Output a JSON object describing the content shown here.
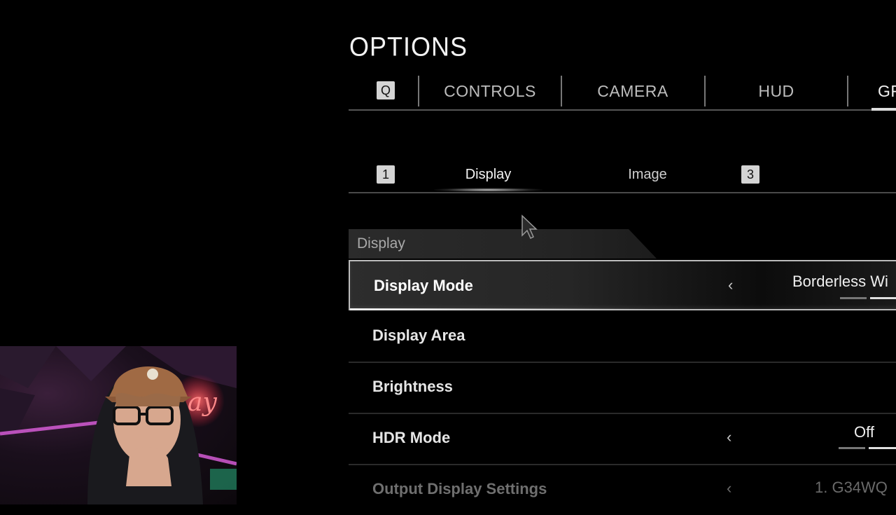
{
  "header": {
    "title": "OPTIONS"
  },
  "tabs": {
    "left_key": "Q",
    "items": [
      {
        "label": "CONTROLS"
      },
      {
        "label": "CAMERA"
      },
      {
        "label": "HUD"
      },
      {
        "label": "GR"
      }
    ]
  },
  "subtabs": {
    "left_key": "1",
    "right_key": "3",
    "items": [
      {
        "label": "Display",
        "active": true
      },
      {
        "label": "Image"
      }
    ]
  },
  "section": {
    "title": "Display"
  },
  "settings": [
    {
      "label": "Display Mode",
      "value": "Borderless Wi",
      "selected": true
    },
    {
      "label": "Display Area"
    },
    {
      "label": "Brightness"
    },
    {
      "label": "HDR Mode",
      "value": "Off"
    },
    {
      "label": "Output Display Settings",
      "value": "1. G34WQ",
      "disabled": true
    }
  ],
  "icons": {
    "chevron": "chevron-left-icon",
    "cursor": "mouse-cursor-icon"
  },
  "colors": {
    "background": "#000000",
    "text": "#e6e6e6",
    "keycap": "#d4d4d4",
    "selected_border": "#bbbbbb"
  }
}
